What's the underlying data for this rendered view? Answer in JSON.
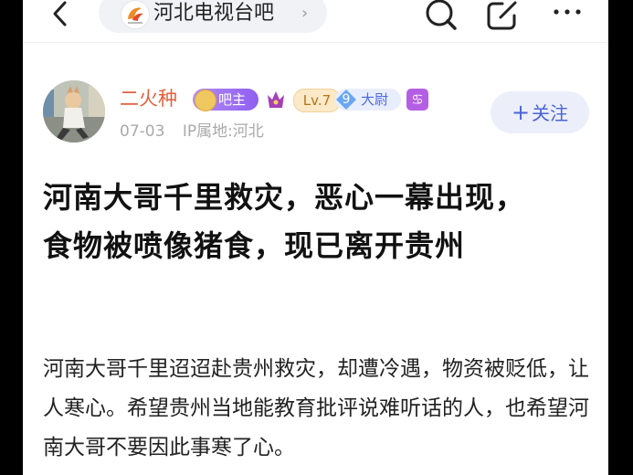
{
  "topbar": {
    "forum_name": "河北电视台吧"
  },
  "author": {
    "username": "二火种",
    "owner_badge": "吧主",
    "level_badge": "Lv.7",
    "rank_number": "9",
    "rank_title": "大尉",
    "zodiac_symbol": "♋",
    "date": "07-03",
    "ip_location": "IP属地:河北"
  },
  "follow_label": "关注",
  "post": {
    "title": "河南大哥千里救灾，恶心一幕出现，食物被喷像猪食，现已离开贵州",
    "body": "河南大哥千里迢迢赴贵州救灾，却遭冷遇，物资被贬低，让人寒心。希望贵州当地能教育批评说难听话的人，也希望河南大哥不要因此事寒了心。"
  },
  "colors": {
    "username": "#e2603e",
    "accent": "#4a63d8",
    "follow_bg": "#eceffa",
    "owner_badge": "#9d6cf2",
    "level_badge": "#fbe9c8",
    "zodiac_badge": "#b45fe3"
  },
  "icons": [
    "back-arrow-icon",
    "search-icon",
    "edit-icon",
    "more-icon",
    "crown-icon",
    "diamond-icon"
  ]
}
